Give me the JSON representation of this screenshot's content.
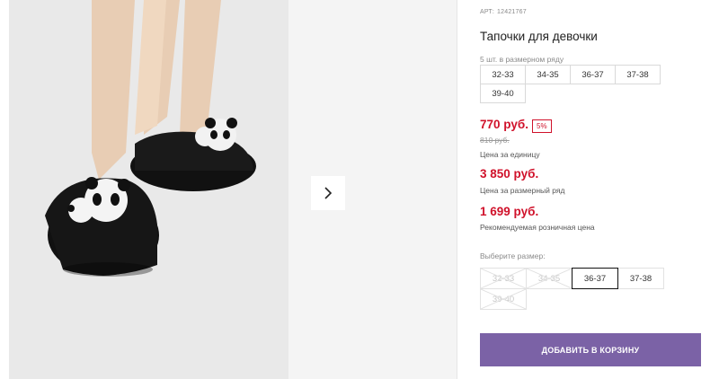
{
  "product": {
    "article_label": "АРТ:",
    "article_number": "12421767",
    "title": "Тапочки для девочки"
  },
  "pack": {
    "label": "5 шт. в размерном ряду",
    "sizes": [
      "32-33",
      "34-35",
      "36-37",
      "37-38",
      "39-40"
    ]
  },
  "prices": {
    "unit_price": "770 руб.",
    "discount": "5%",
    "old_price": "810 руб.",
    "unit_caption": "Цена за единицу",
    "pack_price": "3 850 руб.",
    "pack_caption": "Цена за размерный ряд",
    "retail_price": "1 699 руб.",
    "retail_caption": "Рекомендуемая розничная цена"
  },
  "size_select": {
    "label": "Выберите размер:",
    "options": [
      {
        "label": "32-33",
        "state": "disabled"
      },
      {
        "label": "34-35",
        "state": "disabled"
      },
      {
        "label": "36-37",
        "state": "selected"
      },
      {
        "label": "37-38",
        "state": "available"
      },
      {
        "label": "39-40",
        "state": "disabled"
      }
    ]
  },
  "cart_button": {
    "label": "ДОБАВИТЬ В КОРЗИНУ"
  },
  "gallery": {
    "next_icon": "chevron-right-icon"
  },
  "colors": {
    "accent": "#7b62a6",
    "price": "#d0122b",
    "background": "#f4f4f4"
  }
}
